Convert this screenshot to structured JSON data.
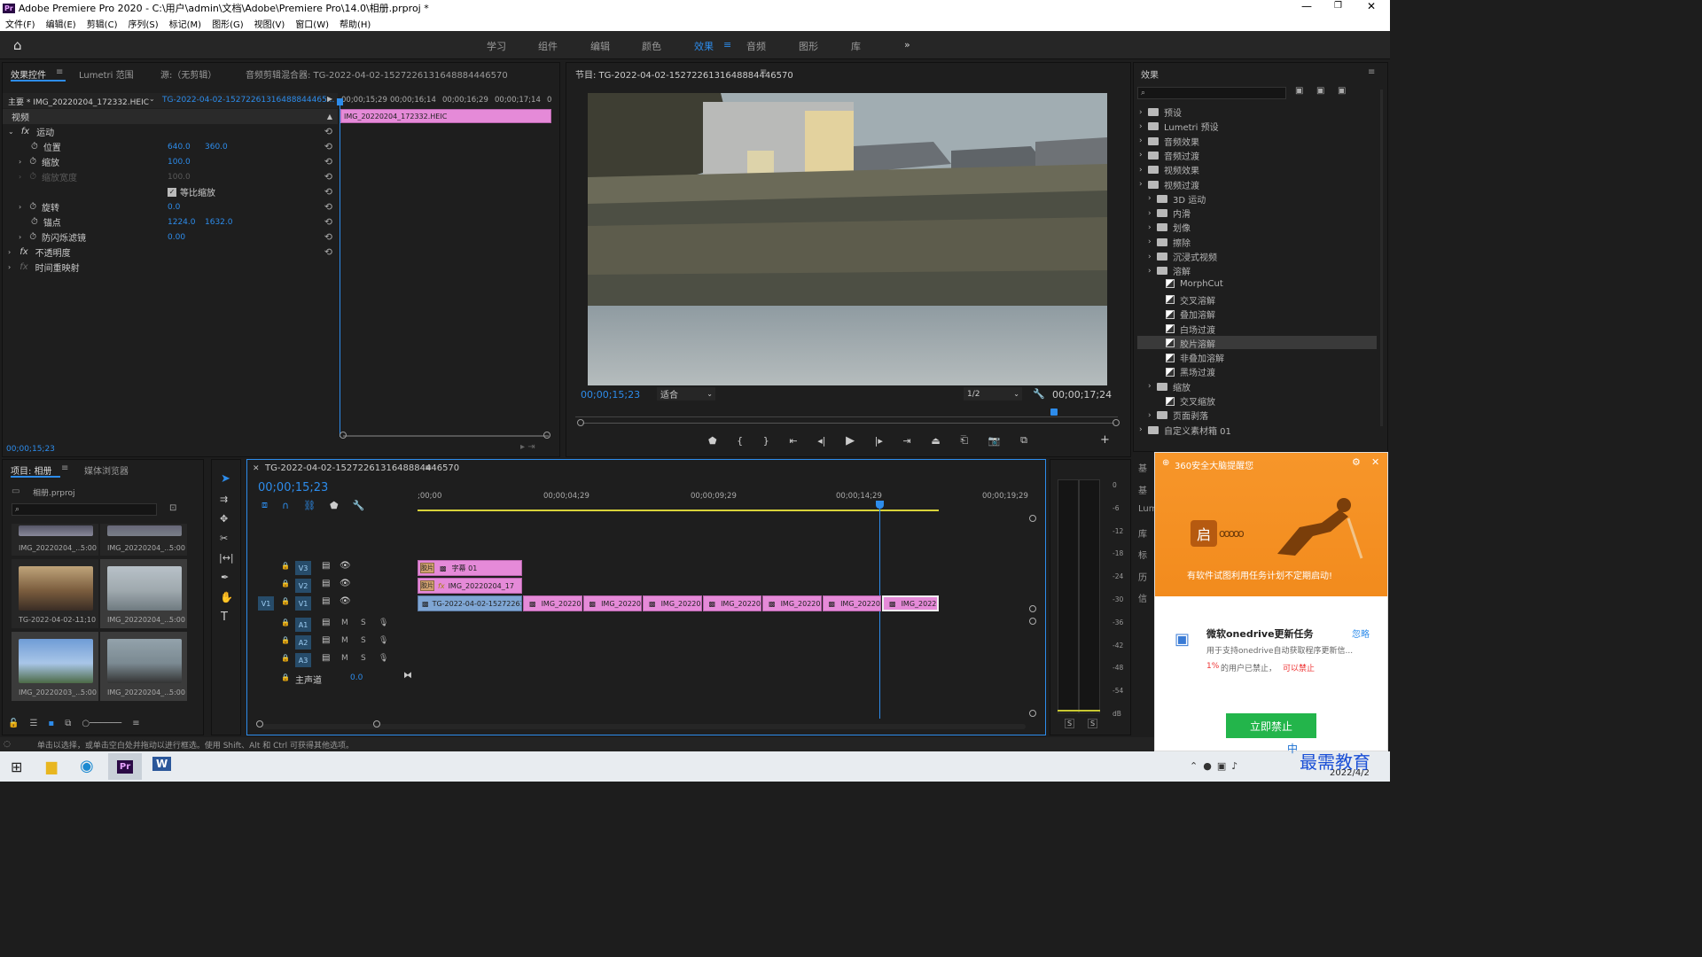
{
  "window": {
    "title": "Adobe Premiere Pro 2020 - C:\\用户\\admin\\文档\\Adobe\\Premiere Pro\\14.0\\相册.prproj *",
    "logo": "Pr"
  },
  "menu": [
    "文件(F)",
    "编辑(E)",
    "剪辑(C)",
    "序列(S)",
    "标记(M)",
    "图形(G)",
    "视图(V)",
    "窗口(W)",
    "帮助(H)"
  ],
  "workspaces": [
    "学习",
    "组件",
    "编辑",
    "颜色",
    "效果",
    "音频",
    "图形",
    "库"
  ],
  "active_workspace": "效果",
  "effect_controls": {
    "tabs": [
      "效果控件",
      "Lumetri 范围",
      "源:（无剪辑）",
      "音频剪辑混合器: TG-2022-04-02-1527226131648884446570"
    ],
    "master": "主要 * IMG_20220204_172332.HEIC",
    "sequence_link": "TG-2022-04-02-15272261316488844465...",
    "timecodes": [
      "00;00;15;29",
      "00;00;16;14",
      "00;00;16;29",
      "00;00;17;14",
      "0"
    ],
    "clip_name": "IMG_20220204_172332.HEIC",
    "section_video": "视频",
    "motion": "运动",
    "position_label": "位置",
    "position_x": "640.0",
    "position_y": "360.0",
    "scale_label": "缩放",
    "scale": "100.0",
    "scale_width_label": "缩放宽度",
    "scale_width": "100.0",
    "uniform_scale": "等比缩放",
    "rotation_label": "旋转",
    "rotation": "0.0",
    "anchor_label": "锚点",
    "anchor_x": "1224.0",
    "anchor_y": "1632.0",
    "flicker_label": "防闪烁滤镜",
    "flicker": "0.00",
    "opacity": "不透明度",
    "time_remap": "时间重映射",
    "current_time": "00;00;15;23"
  },
  "program_monitor": {
    "title": "节目: TG-2022-04-02-1527226131648884446570",
    "timecode": "00;00;15;23",
    "fit": "适合",
    "resolution": "1/2",
    "duration": "00;00;17;24"
  },
  "effects_panel": {
    "title": "效果",
    "items": [
      {
        "label": "预设",
        "type": "folder",
        "level": 0
      },
      {
        "label": "Lumetri 预设",
        "type": "folder",
        "level": 0
      },
      {
        "label": "音频效果",
        "type": "folder",
        "level": 0
      },
      {
        "label": "音频过渡",
        "type": "folder",
        "level": 0
      },
      {
        "label": "视频效果",
        "type": "folder",
        "level": 0
      },
      {
        "label": "视频过渡",
        "type": "folder",
        "level": 0
      },
      {
        "label": "3D 运动",
        "type": "folder",
        "level": 1
      },
      {
        "label": "内滑",
        "type": "folder",
        "level": 1
      },
      {
        "label": "划像",
        "type": "folder",
        "level": 1
      },
      {
        "label": "擦除",
        "type": "folder",
        "level": 1
      },
      {
        "label": "沉浸式视频",
        "type": "folder",
        "level": 1
      },
      {
        "label": "溶解",
        "type": "folder",
        "level": 1
      },
      {
        "label": "MorphCut",
        "type": "effect",
        "level": 2
      },
      {
        "label": "交叉溶解",
        "type": "effect",
        "level": 2
      },
      {
        "label": "叠加溶解",
        "type": "effect",
        "level": 2
      },
      {
        "label": "白场过渡",
        "type": "effect",
        "level": 2
      },
      {
        "label": "胶片溶解",
        "type": "effect",
        "level": 2
      },
      {
        "label": "非叠加溶解",
        "type": "effect",
        "level": 2
      },
      {
        "label": "黑场过渡",
        "type": "effect",
        "level": 2
      },
      {
        "label": "缩放",
        "type": "folder",
        "level": 1
      },
      {
        "label": "交叉缩放",
        "type": "effect",
        "level": 2
      },
      {
        "label": "页面剥落",
        "type": "folder",
        "level": 1
      },
      {
        "label": "自定义素材箱 01",
        "type": "folder",
        "level": 0
      }
    ],
    "selected": "胶片溶解",
    "side_tabs": [
      "基",
      "基",
      "Lum",
      "库",
      "标",
      "历",
      "信"
    ]
  },
  "project": {
    "tabs": [
      "项目: 相册",
      "媒体浏览器"
    ],
    "file": "相册.prproj",
    "thumbs": [
      {
        "name": "IMG_20220204_...",
        "dur": "5:00"
      },
      {
        "name": "IMG_20220204_...",
        "dur": "5:00"
      },
      {
        "name": "TG-2022-04-02-...",
        "dur": "11;10"
      },
      {
        "name": "IMG_20220204_...",
        "dur": "5:00"
      },
      {
        "name": "IMG_20220203_...",
        "dur": "5:00"
      },
      {
        "name": "IMG_20220204_...",
        "dur": "5:00"
      }
    ]
  },
  "timeline": {
    "title": "TG-2022-04-02-1527226131648884446570",
    "timecode": "00;00;15;23",
    "ruler": [
      ";00;00",
      "00;00;04;29",
      "00;00;09;29",
      "00;00;14;29",
      "00;00;19;29"
    ],
    "tracks_video": [
      "V3",
      "V2",
      "V1"
    ],
    "tracks_audio": [
      "A1",
      "A2",
      "A3"
    ],
    "master": "主声道",
    "master_value": "0.0",
    "clip_v3": "字幕 01",
    "clip_v2": "IMG_20220204_17",
    "clip_v1_first": "TG-2022-04-02-1527226131",
    "clips_v1": [
      "IMG_20220",
      "IMG_20220",
      "IMG_20220",
      "IMG_20220",
      "IMG_20220",
      "IMG_20220",
      "IMG_2022"
    ],
    "fx_badge": "fx",
    "film_badge": "胶片"
  },
  "meter": {
    "scale": [
      "0",
      "-6",
      "-12",
      "-18",
      "-24",
      "-30",
      "-36",
      "-42",
      "-48",
      "-54",
      "dB"
    ],
    "solo": "S"
  },
  "status": "单击以选择，或单击空白处并拖动以进行框选。使用 Shift、Alt 和 Ctrl 可获得其他选项。",
  "popup": {
    "title": "360安全大脑提醒您",
    "warning": "有软件试图利用任务计划不定期启动!",
    "item_title": "微软onedrive更新任务",
    "item_desc": "用于支持onedrive自动获取程序更新信...",
    "ignore": "忽略",
    "stat_pct": "1%",
    "stat_text": "的用户已禁止，",
    "stat_link": "可以禁止",
    "button": "立即禁止",
    "badge": "启"
  },
  "taskbar": {
    "watermark": "最需教育",
    "date": "2022/4/2",
    "ime": "中"
  },
  "colors": {
    "accent": "#2d8ceb",
    "pink_clip": "#e58ad8",
    "blue_clip": "#7fa6d4",
    "popup_orange": "#f7962a",
    "popup_button": "#23b54b"
  }
}
